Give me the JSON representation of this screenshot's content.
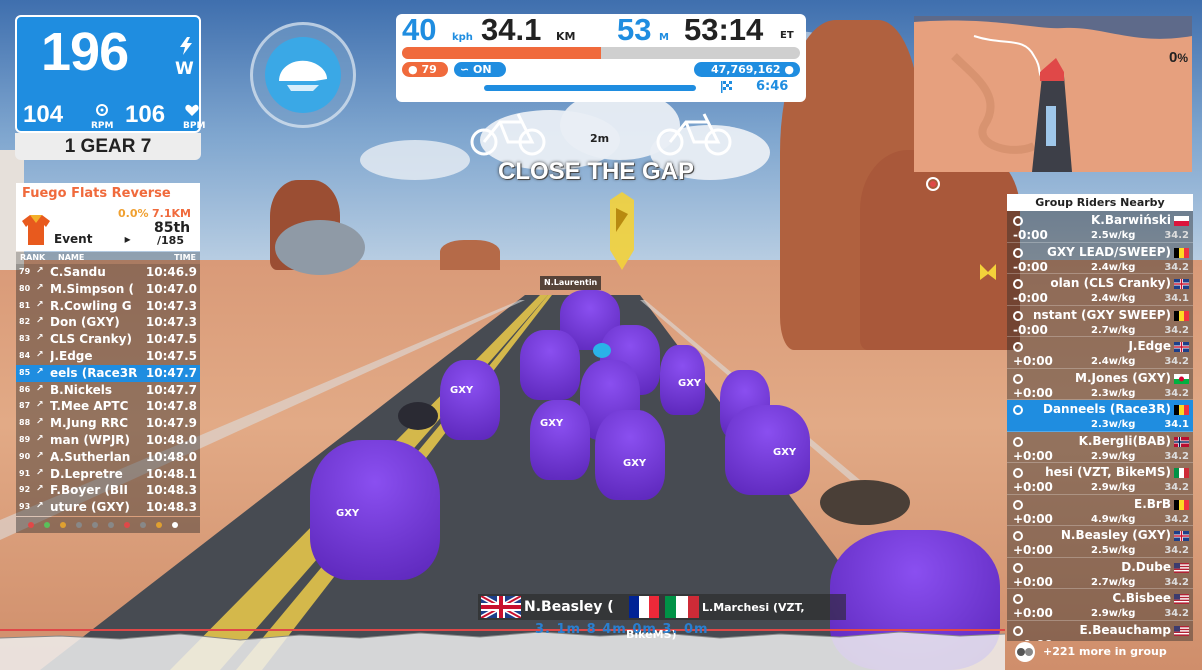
{
  "power": {
    "watts": "196",
    "watts_unit": "W",
    "cadence": "104",
    "cadence_unit": "RPM",
    "heart_rate": "106",
    "heart_rate_unit": "BPM",
    "gear": "1 GEAR 7"
  },
  "hud": {
    "speed": "40",
    "speed_unit": "kph",
    "distance": "34.1",
    "distance_unit": "KM",
    "elevation": "53",
    "elevation_unit": "M",
    "elapsed": "53:14",
    "elapsed_unit": "ET",
    "progress_fraction": 0.5,
    "cadence_badge": "79",
    "on_badge": "ON",
    "drops": "47,769,162",
    "remaining": "6:46"
  },
  "gap_banner": {
    "distance": "2m",
    "text": "CLOSE THE GAP"
  },
  "minimap": {
    "grade": "0",
    "grade_unit": "%"
  },
  "event": {
    "route": "Fuego Flats Reverse",
    "grade": "0.0%",
    "distance": "7.1KM",
    "position": "85th",
    "total": "/185",
    "label": "Event"
  },
  "leaderboard": {
    "headers": {
      "rank": "RANK",
      "name": "NAME",
      "time": "TIME"
    },
    "rows": [
      {
        "rank": "79",
        "name": "C.Sandu",
        "time": "10:46.9",
        "me": false
      },
      {
        "rank": "80",
        "name": "M.Simpson (",
        "time": "10:47.0",
        "me": false
      },
      {
        "rank": "81",
        "name": "R.Cowling G",
        "time": "10:47.3",
        "me": false
      },
      {
        "rank": "82",
        "name": "Don (GXY)",
        "time": "10:47.3",
        "me": false
      },
      {
        "rank": "83",
        "name": "CLS Cranky)",
        "time": "10:47.5",
        "me": false
      },
      {
        "rank": "84",
        "name": "J.Edge",
        "time": "10:47.5",
        "me": false
      },
      {
        "rank": "85",
        "name": "eels (Race3R",
        "time": "10:47.7",
        "me": true
      },
      {
        "rank": "86",
        "name": "B.Nickels",
        "time": "10:47.7",
        "me": false
      },
      {
        "rank": "87",
        "name": "T.Mee APTC",
        "time": "10:47.8",
        "me": false
      },
      {
        "rank": "88",
        "name": "M.Jung RRC",
        "time": "10:47.9",
        "me": false
      },
      {
        "rank": "89",
        "name": "man (WPJR)",
        "time": "10:48.0",
        "me": false
      },
      {
        "rank": "90",
        "name": "A.Sutherlan",
        "time": "10:48.0",
        "me": false
      },
      {
        "rank": "91",
        "name": "D.Lepretre",
        "time": "10:48.1",
        "me": false
      },
      {
        "rank": "92",
        "name": "F.Boyer (BII",
        "time": "10:48.3",
        "me": false
      },
      {
        "rank": "93",
        "name": "uture (GXY)",
        "time": "10:48.3",
        "me": false
      }
    ]
  },
  "group": {
    "title": "Group Riders Nearby",
    "rows": [
      {
        "name": "K.Barwiński",
        "gap": "-0:00",
        "wkg": "2.5w/kg",
        "spd": "34.2",
        "flag": "pl",
        "me": false
      },
      {
        "name": "GXY LEAD/SWEEP)",
        "gap": "-0:00",
        "wkg": "2.4w/kg",
        "spd": "34.2",
        "flag": "be",
        "me": false
      },
      {
        "name": "olan (CLS Cranky)",
        "gap": "-0:00",
        "wkg": "2.4w/kg",
        "spd": "34.1",
        "flag": "gb",
        "me": false
      },
      {
        "name": "nstant (GXY SWEEP)",
        "gap": "-0:00",
        "wkg": "2.7w/kg",
        "spd": "34.2",
        "flag": "be",
        "me": false
      },
      {
        "name": "J.Edge",
        "gap": "+0:00",
        "wkg": "2.4w/kg",
        "spd": "34.2",
        "flag": "gb",
        "me": false
      },
      {
        "name": "M.Jones (GXY)",
        "gap": "+0:00",
        "wkg": "2.3w/kg",
        "spd": "34.2",
        "flag": "wales",
        "me": false
      },
      {
        "name": "Danneels (Race3R)",
        "gap": "",
        "wkg": "2.3w/kg",
        "spd": "34.1",
        "flag": "be",
        "me": true
      },
      {
        "name": "K.Bergli(BAB)",
        "gap": "+0:00",
        "wkg": "2.9w/kg",
        "spd": "34.2",
        "flag": "no",
        "me": false
      },
      {
        "name": "hesi (VZT, BikeMS)",
        "gap": "+0:00",
        "wkg": "2.9w/kg",
        "spd": "34.2",
        "flag": "it",
        "me": false
      },
      {
        "name": "E.BrB",
        "gap": "+0:00",
        "wkg": "4.9w/kg",
        "spd": "34.2",
        "flag": "be",
        "me": false
      },
      {
        "name": "N.Beasley (GXY)",
        "gap": "+0:00",
        "wkg": "2.5w/kg",
        "spd": "34.2",
        "flag": "gb",
        "me": false
      },
      {
        "name": "D.Dube",
        "gap": "+0:00",
        "wkg": "2.7w/kg",
        "spd": "34.2",
        "flag": "us",
        "me": false
      },
      {
        "name": "C.Bisbee",
        "gap": "+0:00",
        "wkg": "2.9w/kg",
        "spd": "34.2",
        "flag": "us",
        "me": false
      },
      {
        "name": "E.Beauchamp",
        "gap": "+0:00",
        "wkg": "",
        "spd": "",
        "flag": "us",
        "me": false
      }
    ],
    "more": "+221 more in group"
  },
  "name_tags": {
    "left_name": "N.Beasley (",
    "right_name": "L.Marchesi (VZT, BikeMS)",
    "jersey_text": "GXY",
    "bottom_gaps": "3. 1m  8  4m  0m  3.  0m"
  },
  "nameplate_front": "N.Laurentin"
}
